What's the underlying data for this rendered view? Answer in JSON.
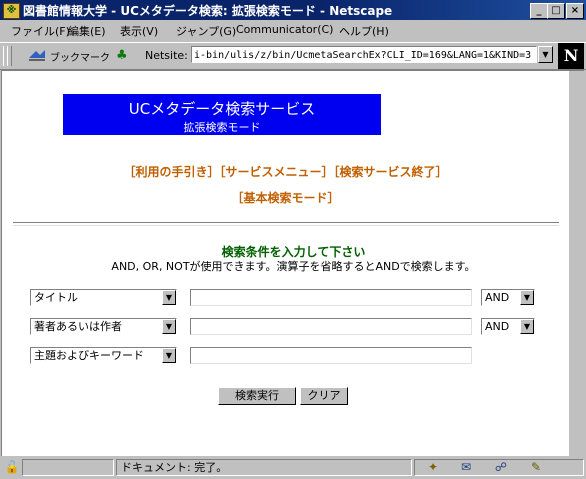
{
  "window": {
    "title": "図書館情報大学 - UCメタデータ検索: 拡張検索モード - Netscape",
    "app_icon": "ulis-icon",
    "controls": [
      "minimize-icon",
      "maximize-icon",
      "close-icon"
    ]
  },
  "menu": {
    "items": [
      "ファイル(F)",
      "編集(E)",
      "表示(V)",
      "ジャンプ(G)",
      "Communicator(C)",
      "ヘルプ(H)"
    ]
  },
  "toolbar": {
    "bookmarks_label": "ブックマーク",
    "location_label": "Netsite:",
    "url": "i-bin/ulis/z/bin/UcmetaSearchEx?CLI_ID=169&LANG=1&KIND=3",
    "logo": "N"
  },
  "banner": {
    "title": "UCメタデータ検索サービス",
    "subtitle": "拡張検索モード"
  },
  "nav": {
    "guide": "［利用の手引き］",
    "menu": "［サービスメニュー］",
    "exit": "［検索サービス終了］",
    "basic": "［基本検索モード］"
  },
  "form": {
    "heading": "検索条件を入力して下さい",
    "instructions": "AND, OR, NOTが使用できます。演算子を省略するとANDで検索します。",
    "rows": [
      {
        "field": "タイトル",
        "value": "",
        "operator": "AND"
      },
      {
        "field": "著者あるいは作者",
        "value": "",
        "operator": "AND"
      },
      {
        "field": "主題およびキーワード",
        "value": ""
      }
    ],
    "search_button": "検索実行",
    "clear_button": "クリア"
  },
  "status": {
    "text": "ドキュメント: 完了。"
  },
  "colors": {
    "banner_bg": "#0000f0",
    "link": "#c06000",
    "heading": "#006000",
    "titlebar": "#0a246a"
  }
}
